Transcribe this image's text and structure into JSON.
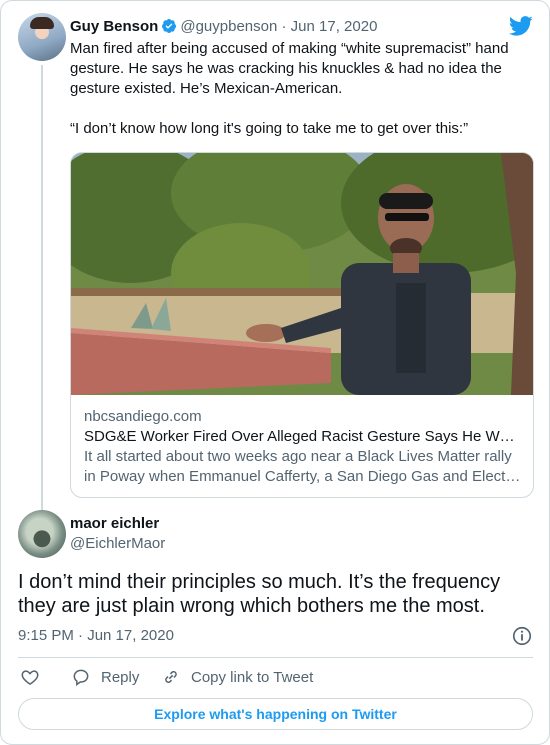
{
  "quoted_tweet": {
    "author_name": "Guy Benson",
    "handle": "@guypbenson",
    "separator": "·",
    "date": "Jun 17, 2020",
    "text": "Man fired after being accused of making “white supremacist” hand gesture. He says he was cracking his knuckles & had no idea the gesture existed. He’s Mexican-American.\n\n“I don’t know how long it's going to take me to get over this:”",
    "link_card": {
      "domain": "nbcsandiego.com",
      "title": "SDG&E Worker Fired Over Alleged Racist Gesture Says He W…",
      "description": "It all started about two weeks ago near a Black Lives Matter rally in Poway when Emmanuel Cafferty, a San Diego Gas and Elect…"
    }
  },
  "reply_tweet": {
    "author_name": "maor eichler",
    "handle": "@EichlerMaor",
    "text": "I don’t mind their principles so much. It’s the frequency they are just plain wrong which bothers me the most.",
    "timestamp": "9:15 PM · Jun 17, 2020"
  },
  "actions": {
    "reply_label": "Reply",
    "copy_link_label": "Copy link to Tweet"
  },
  "explore_label": "Explore what's happening on Twitter",
  "colors": {
    "accent": "#1d9bf0",
    "text": "#0f1419",
    "muted": "#536471",
    "border": "#cfd9de"
  },
  "icons": [
    "twitter-bird-icon",
    "verified-badge-icon",
    "info-icon",
    "heart-icon",
    "reply-icon",
    "link-icon"
  ]
}
